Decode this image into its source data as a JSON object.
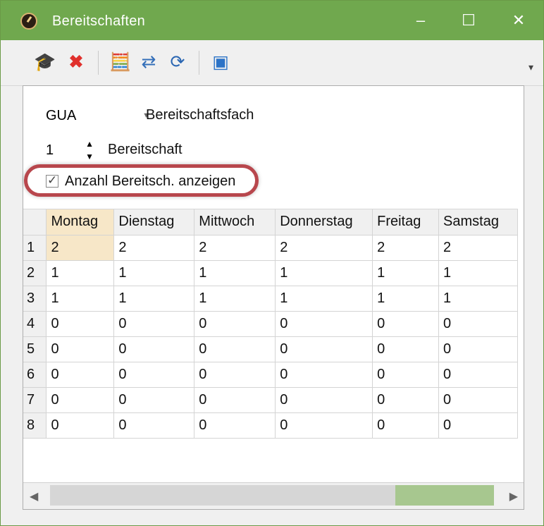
{
  "window": {
    "title": "Bereitschaften",
    "controls": [
      "‒",
      "☐",
      "✕"
    ]
  },
  "toolbar": {
    "icons": [
      "graduation-cap-icon",
      "delete-icon",
      "calculator-icon",
      "transfer-icon",
      "refresh-icon",
      "export-icon"
    ],
    "overflow": "▾"
  },
  "filters": {
    "subject_value": "GUA",
    "subject_label": "Bereitschaftsfach",
    "readiness_value": "1",
    "readiness_label": "Bereitschaft",
    "show_count_label": "Anzahl Bereitsch. anzeigen",
    "show_count_checked": true
  },
  "table": {
    "headers": [
      "Montag",
      "Dienstag",
      "Mittwoch",
      "Donnerstag",
      "Freitag",
      "Samstag"
    ],
    "rows": [
      {
        "label": "1",
        "values": [
          "2",
          "2",
          "2",
          "2",
          "2",
          "2"
        ]
      },
      {
        "label": "2",
        "values": [
          "1",
          "1",
          "1",
          "1",
          "1",
          "1"
        ]
      },
      {
        "label": "3",
        "values": [
          "1",
          "1",
          "1",
          "1",
          "1",
          "1"
        ]
      },
      {
        "label": "4",
        "values": [
          "0",
          "0",
          "0",
          "0",
          "0",
          "0"
        ]
      },
      {
        "label": "5",
        "values": [
          "0",
          "0",
          "0",
          "0",
          "0",
          "0"
        ]
      },
      {
        "label": "6",
        "values": [
          "0",
          "0",
          "0",
          "0",
          "0",
          "0"
        ]
      },
      {
        "label": "7",
        "values": [
          "0",
          "0",
          "0",
          "0",
          "0",
          "0"
        ]
      },
      {
        "label": "8",
        "values": [
          "0",
          "0",
          "0",
          "0",
          "0",
          "0"
        ]
      }
    ]
  },
  "colors": {
    "titlebar": "#70a84e",
    "selection": "#f7e7c8",
    "highlight": "#b8474d"
  }
}
